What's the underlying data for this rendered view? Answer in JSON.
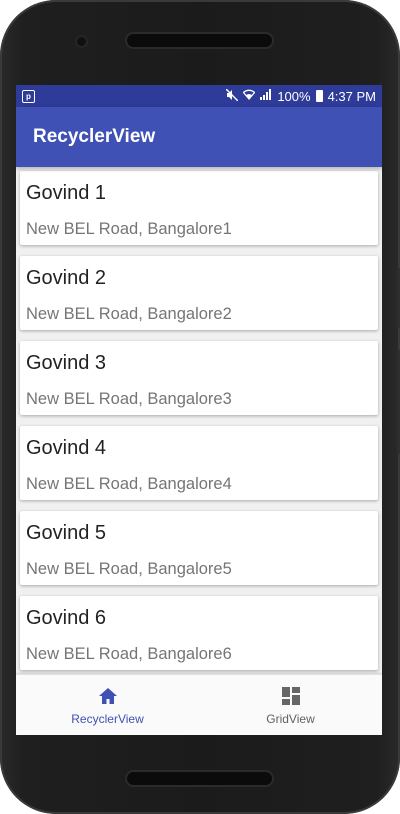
{
  "status_bar": {
    "notification_icon": "p",
    "battery": "100%",
    "time": "4:37 PM"
  },
  "app_bar": {
    "title": "RecyclerView"
  },
  "list": {
    "items": [
      {
        "name": "Govind 1",
        "address": "New BEL Road, Bangalore1"
      },
      {
        "name": "Govind 2",
        "address": "New BEL Road, Bangalore2"
      },
      {
        "name": "Govind 3",
        "address": "New BEL Road, Bangalore3"
      },
      {
        "name": "Govind 4",
        "address": "New BEL Road, Bangalore4"
      },
      {
        "name": "Govind 5",
        "address": "New BEL Road, Bangalore5"
      },
      {
        "name": "Govind 6",
        "address": "New BEL Road, Bangalore6"
      }
    ]
  },
  "bottom_nav": {
    "items": [
      {
        "label": "RecyclerView",
        "icon": "home-icon",
        "active": true
      },
      {
        "label": "GridView",
        "icon": "dashboard-icon",
        "active": false
      }
    ]
  },
  "colors": {
    "primary": "#3f51b5",
    "primary_dark": "#2e3b99",
    "secondary_text": "#757575"
  }
}
